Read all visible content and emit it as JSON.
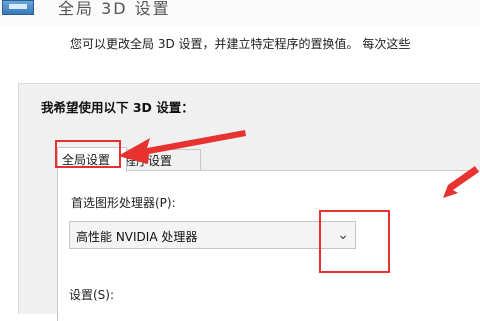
{
  "window": {
    "title_fragment": "全局 3D 设置"
  },
  "description": "您可以更改全局 3D 设置，并建立特定程序的置换值。 每次这些",
  "panel": {
    "heading": "我希望使用以下 3D 设置："
  },
  "tabs": [
    {
      "label": "全局设置",
      "selected": true
    },
    {
      "label": "程序设置",
      "selected": false
    }
  ],
  "graphics_processor": {
    "label": "首选图形处理器(P):",
    "selected": "高性能 NVIDIA 处理器"
  },
  "settings": {
    "label": "设置(S):"
  },
  "annotations": {
    "color": "#e8322f"
  }
}
